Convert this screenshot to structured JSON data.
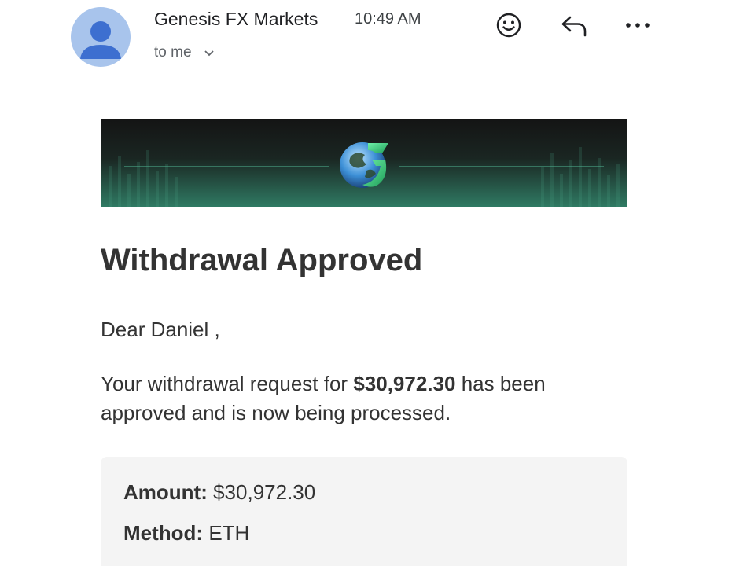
{
  "header": {
    "sender_name": "Genesis FX Markets",
    "time": "10:49 AM",
    "recipient": "to me",
    "icons": {
      "avatar": "person-avatar-icon",
      "recipient_toggle": "chevron-down-icon",
      "emoji": "emoji-reaction-icon",
      "reply": "reply-icon",
      "more": "more-options-icon"
    }
  },
  "email": {
    "title": "Withdrawal Approved",
    "greeting": "Dear Daniel ,",
    "message_start": "Your withdrawal request for ",
    "message_amount": "$30,972.30",
    "message_end": " has been approved and is now being processed.",
    "details": [
      {
        "label": "Amount:",
        "value": "$30,972.30"
      },
      {
        "label": "Method:",
        "value": "ETH"
      }
    ]
  },
  "colors": {
    "avatar_bg": "#a8c4ec",
    "avatar_fg": "#3d6fd0",
    "banner_dark": "#141414",
    "banner_teal": "#2b6e5a",
    "logo_green": "#2fbf71",
    "text": "#333333",
    "details_bg": "#f4f4f4"
  }
}
